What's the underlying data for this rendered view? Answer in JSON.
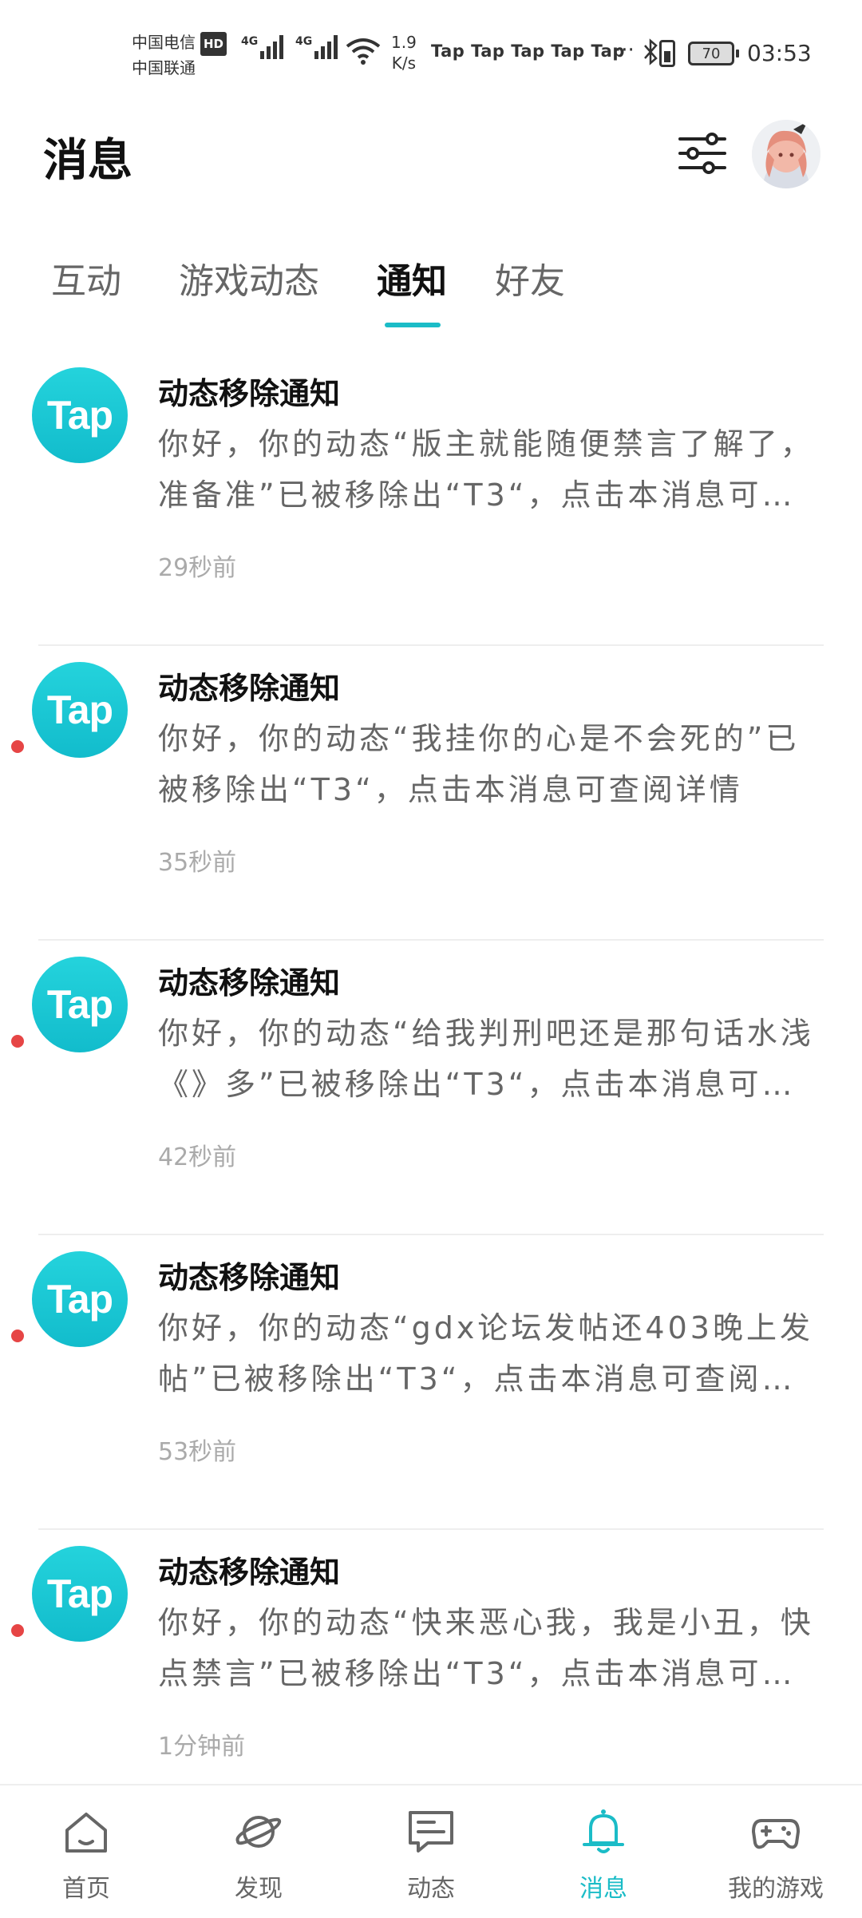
{
  "status_bar": {
    "carrier1": "中国电信",
    "hd": "HD",
    "carrier2": "中国联通",
    "net1": "4G",
    "net2": "4G",
    "speed_value": "1.9",
    "speed_unit": "K/s",
    "app_icons": "Tap Tap Tap Tap Tap",
    "more": "···",
    "battery": "70",
    "time": "03:53"
  },
  "header": {
    "title": "消息"
  },
  "tabs": [
    {
      "label": "互动",
      "active": false
    },
    {
      "label": "游戏动态",
      "active": false
    },
    {
      "label": "通知",
      "active": true
    },
    {
      "label": "好友",
      "active": false
    }
  ],
  "colors": {
    "accent": "#1bbcc7",
    "unread": "#e64545",
    "logo": "#12bccc"
  },
  "notifications": [
    {
      "logo": "Tap",
      "title": "动态移除通知",
      "body": "你好，你的动态“版主就能随便禁言了解了，准备准”已被移除出“T3“，点击本消息可查阅详情",
      "time": "29秒前",
      "unread": false
    },
    {
      "logo": "Tap",
      "title": "动态移除通知",
      "body": "你好，你的动态“我挂你的心是不会死的”已被移除出“T3“，点击本消息可查阅详情",
      "time": "35秒前",
      "unread": true
    },
    {
      "logo": "Tap",
      "title": "动态移除通知",
      "body": "你好，你的动态“给我判刑吧还是那句话水浅《》多”已被移除出“T3“，点击本消息可查阅详情",
      "time": "42秒前",
      "unread": true
    },
    {
      "logo": "Tap",
      "title": "动态移除通知",
      "body": "你好，你的动态“gdx论坛发帖还403晚上发帖”已被移除出“T3“，点击本消息可查阅详情",
      "time": "53秒前",
      "unread": true
    },
    {
      "logo": "Tap",
      "title": "动态移除通知",
      "body": "你好，你的动态“快来恶心我，我是小丑，快点禁言”已被移除出“T3“，点击本消息可查阅详情",
      "time": "1分钟前",
      "unread": true
    }
  ],
  "bottom_nav": [
    {
      "label": "首页",
      "icon": "home-icon",
      "active": false
    },
    {
      "label": "发现",
      "icon": "planet-icon",
      "active": false
    },
    {
      "label": "动态",
      "icon": "chat-icon",
      "active": false
    },
    {
      "label": "消息",
      "icon": "bell-icon",
      "active": true
    },
    {
      "label": "我的游戏",
      "icon": "gamepad-icon",
      "active": false
    }
  ]
}
